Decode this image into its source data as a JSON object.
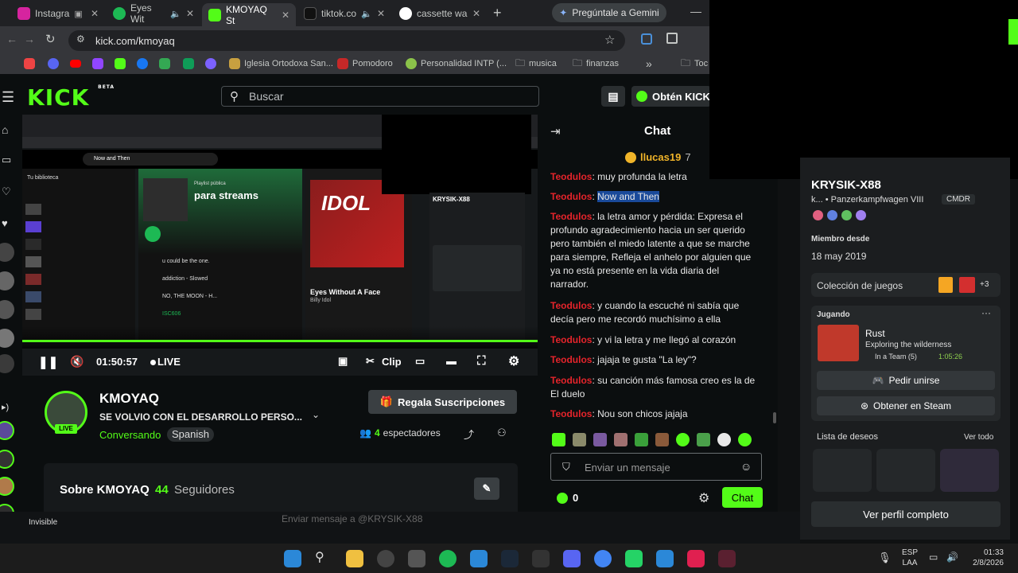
{
  "browser": {
    "tabs": [
      {
        "label": "Instagra",
        "color": "#d6249f"
      },
      {
        "label": "Eyes Wit",
        "color": "#1db954"
      },
      {
        "label": "KMOYAQ St",
        "color": "#53fc18"
      },
      {
        "label": "tiktok.co",
        "color": "#111111"
      },
      {
        "label": "cassette wa",
        "color": "#4285f4"
      }
    ],
    "gemini_label": "Pregúntale a Gemini",
    "url": "kick.com/kmoyaq",
    "bookmarks": [
      "Iglesia Ortodoxa San...",
      "Pomodoro",
      "Personalidad INTP (...",
      "musica",
      "finanzas",
      "Toc"
    ]
  },
  "kick": {
    "logo": "KICK",
    "logo_badge": "BETA",
    "search_placeholder": "Buscar",
    "get_kick": "Obtén KICK",
    "player": {
      "time": "01:50:57",
      "live": "LIVE",
      "clip": "Clip",
      "progress": 1.0
    },
    "embedded": {
      "playlist_type": "Playlist pública",
      "playlist_title": "para streams",
      "song_title": "Eyes Without A Face",
      "artist": "Billy Idol",
      "album_text": "IDOL",
      "search_text": "Now and Then",
      "library": "Tu biblioteca",
      "steam_user": "KRYSIK-X88",
      "tracks": [
        "u could be the one.",
        "addiction - Slowed",
        "NO, THE MOON - H...",
        "ISC606"
      ]
    },
    "channel": {
      "name": "KMOYAQ",
      "title": "SE VOLVIO CON EL DESARROLLO PERSO...",
      "category": "Conversando",
      "language": "Spanish",
      "viewers": "4",
      "viewers_label": "espectadores",
      "gift_button": "Regala Suscripciones",
      "live_badge": "LIVE",
      "about": "Sobre KMOYAQ",
      "followers": "44",
      "followers_label": "Seguidores"
    },
    "chat": {
      "title": "Chat",
      "pinned_user": "llucas19",
      "pinned_count": "7",
      "messages": [
        {
          "user": "Teodulos",
          "text": "muy profunda la letra"
        },
        {
          "user": "Teodulos",
          "text": "Now and Then"
        },
        {
          "user": "Teodulos",
          "text": "la letra amor y pérdida: Expresa el profundo agradecimiento hacia un ser querido pero también el miedo latente a que se marche para siempre, Refleja el anhelo por alguien que ya no está presente en la vida diaria del narrador."
        },
        {
          "user": "Teodulos",
          "text": "y cuando la escuché ni sabía que decía pero me recordó muchísimo a ella"
        },
        {
          "user": "Teodulos",
          "text": "y vi la letra y me llegó al corazón"
        },
        {
          "user": "Teodulos",
          "text": "jajaja te gusta \"La ley\"?"
        },
        {
          "user": "Teodulos",
          "text": "su canción más famosa creo es la de El duelo"
        },
        {
          "user": "Teodulos",
          "text": "Nou son chicos jajaja"
        }
      ],
      "input_placeholder": "Enviar un mensaje",
      "kick_count": "0",
      "send_button": "Chat"
    }
  },
  "steam": {
    "username": "KRYSIK-X88",
    "subtitle": "k... • Panzerkampfwagen VIII",
    "badge": "CMDR",
    "member_since_label": "Miembro desde",
    "member_since": "18 may 2019",
    "collection_label": "Colección de juegos",
    "collection_more": "+3",
    "playing_label": "Jugando",
    "game_name": "Rust",
    "game_status": "Exploring the wilderness",
    "game_team": "In a Team (5)",
    "game_time": "1:05:26",
    "join_button": "Pedir unirse",
    "get_button": "Obtener en Steam",
    "wishlist_label": "Lista de deseos",
    "see_all": "Ver todo",
    "full_profile": "Ver perfil completo",
    "status": "Invisible",
    "dm_placeholder": "Enviar mensaje a @KRYSIK-X88"
  },
  "taskbar": {
    "lang": "ESP",
    "lang2": "LAA",
    "time": "01:33",
    "date": "2/8/2026"
  }
}
